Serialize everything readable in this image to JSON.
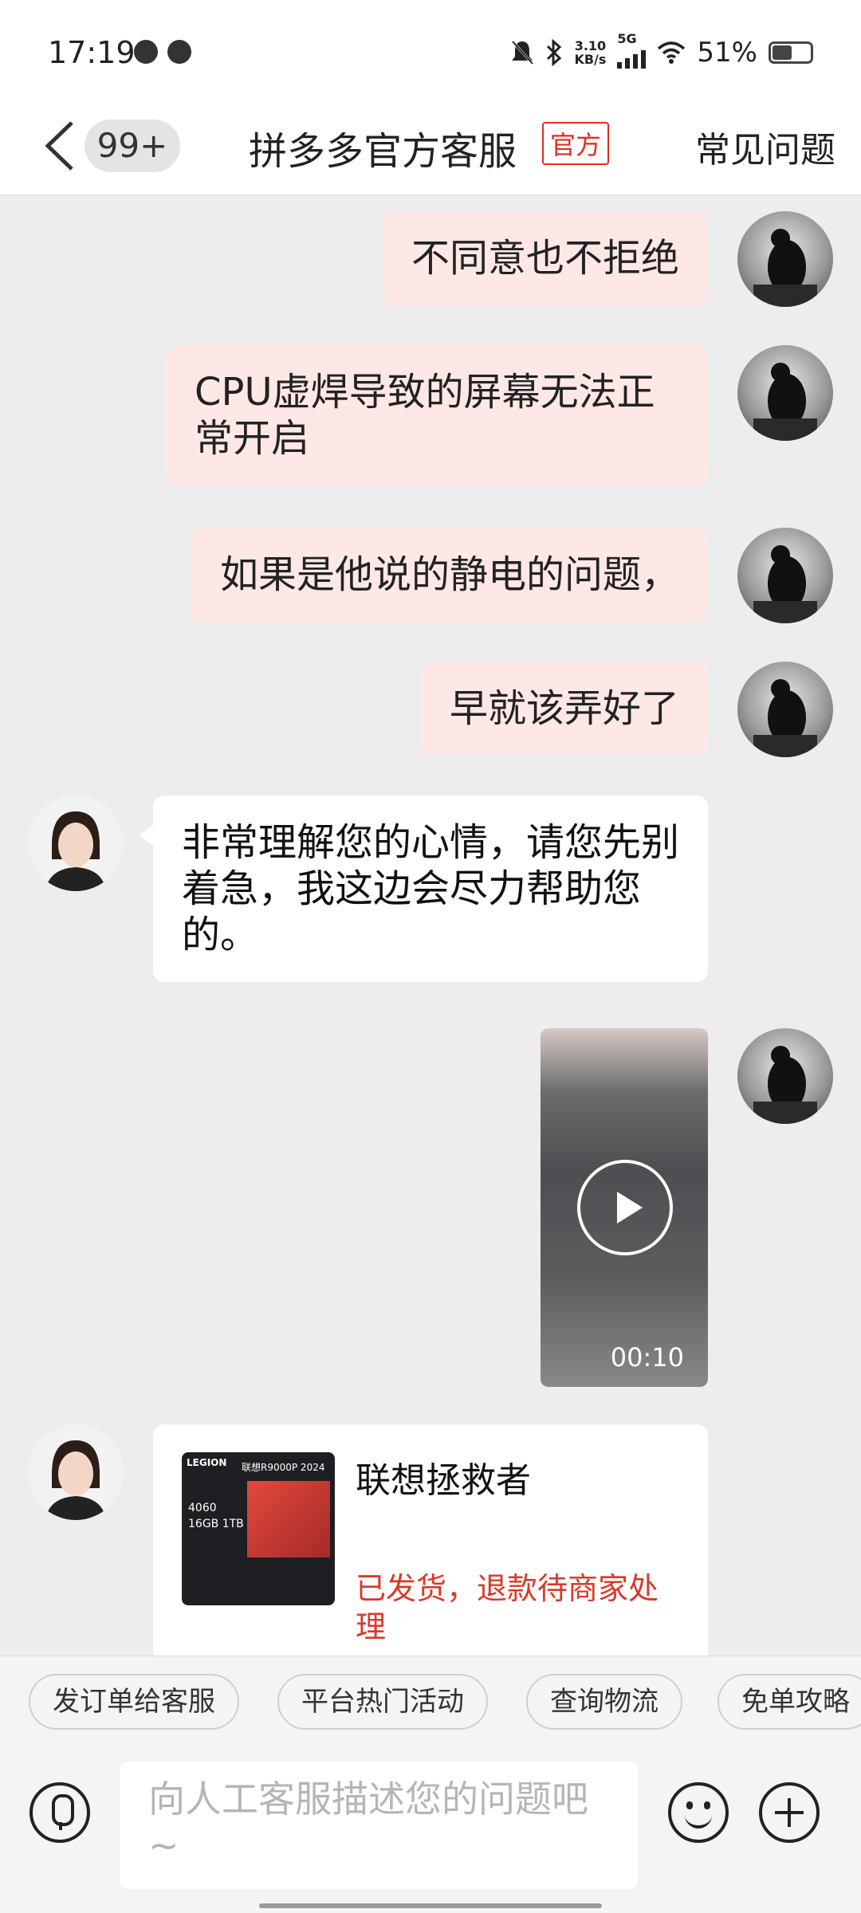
{
  "status_bar": {
    "time": "17:19",
    "network_speed_value": "3.10",
    "network_speed_unit": "KB/s",
    "network_type": "5G",
    "battery": "51%"
  },
  "header": {
    "unread_badge": "99+",
    "title": "拼多多官方客服",
    "official_tag": "官方",
    "faq_label": "常见问题"
  },
  "messages": [
    {
      "from": "user",
      "text": "不同意也不拒绝"
    },
    {
      "from": "user",
      "text": "CPU虚焊导致的屏幕无法正常开启"
    },
    {
      "from": "user",
      "text": "如果是他说的静电的问题，"
    },
    {
      "from": "user",
      "text": "早就该弄好了"
    },
    {
      "from": "agent",
      "text": "非常理解您的心情，请您先别着急，我这边会尽力帮助您的。"
    },
    {
      "from": "user",
      "type": "video",
      "duration": "00:10"
    },
    {
      "from": "agent",
      "type": "order_card",
      "product_name": "联想拯救者",
      "status": "已发货，退款待商家处理",
      "thumb_brand": "LEGION",
      "thumb_model": "联想R9000P 2024",
      "thumb_specs": "4060 16GB 1TB"
    }
  ],
  "quick_replies": [
    "发订单给客服",
    "平台热门活动",
    "查询物流",
    "免单攻略"
  ],
  "input": {
    "placeholder": "向人工客服描述您的问题吧~"
  },
  "colors": {
    "accent": "#e02e24",
    "outgoing_bubble": "#fde8e6",
    "chat_bg": "#ededed"
  },
  "icons": [
    "back-arrow-icon",
    "mic-icon",
    "emoji-icon",
    "plus-icon",
    "play-icon",
    "wifi-icon",
    "bluetooth-icon",
    "mute-bell-icon"
  ]
}
